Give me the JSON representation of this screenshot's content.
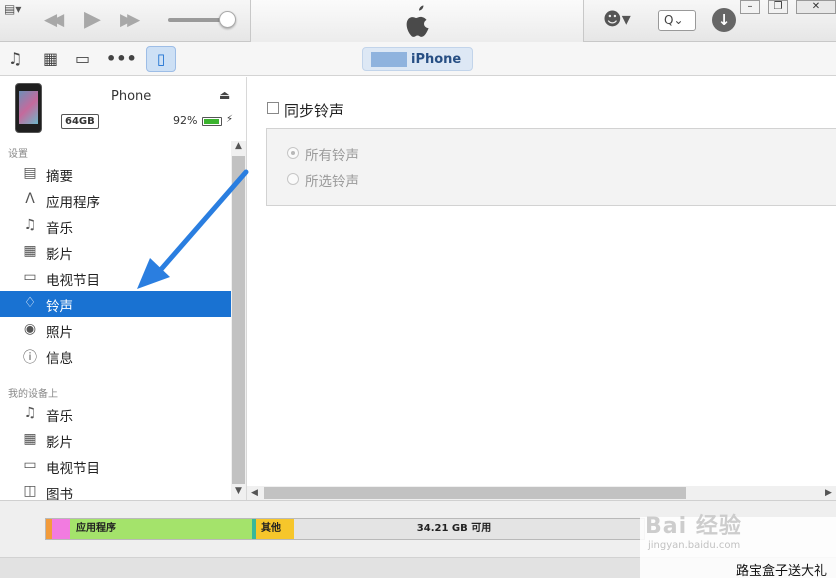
{
  "toolbar": {
    "menu_icon": "menu-icon",
    "prev_icon": "rewind-icon",
    "play_icon": "play-icon",
    "next_icon": "fast-forward-icon",
    "volume_level": 0.85,
    "apple_icon": "apple-logo-icon",
    "account_icon": "account-icon",
    "search_icon": "search-icon",
    "download_icon": "download-icon"
  },
  "navbar": {
    "icons": [
      "music-icon",
      "film-icon",
      "tv-icon",
      "more-icon",
      "iphone-icon"
    ],
    "device_label": "iPhone"
  },
  "device": {
    "name": "Phone",
    "capacity": "64GB",
    "battery": "92%",
    "battery_level": 0.92
  },
  "sidebar": {
    "settings_header": "设置",
    "settings_items": [
      {
        "label": "摘要",
        "icon": "summary-icon"
      },
      {
        "label": "应用程序",
        "icon": "apps-icon"
      },
      {
        "label": "音乐",
        "icon": "music-icon"
      },
      {
        "label": "影片",
        "icon": "film-icon"
      },
      {
        "label": "电视节目",
        "icon": "tv-icon"
      },
      {
        "label": "铃声",
        "icon": "bell-icon",
        "selected": true
      },
      {
        "label": "照片",
        "icon": "camera-icon"
      },
      {
        "label": "信息",
        "icon": "info-icon"
      }
    ],
    "mydevice_header": "我的设备上",
    "mydevice_items": [
      {
        "label": "音乐",
        "icon": "music-icon"
      },
      {
        "label": "影片",
        "icon": "film-icon"
      },
      {
        "label": "电视节目",
        "icon": "tv-icon"
      },
      {
        "label": "图书",
        "icon": "book-icon"
      }
    ]
  },
  "main": {
    "sync_label": "同步铃声",
    "sync_checked": false,
    "options": [
      {
        "label": "所有铃声",
        "selected": true
      },
      {
        "label": "所选铃声",
        "selected": false
      }
    ]
  },
  "capacity": {
    "apps_label": "应用程序",
    "other_label": "其他",
    "free_label": "34.21 GB 可用"
  },
  "watermark": {
    "logo": "Bai 经验",
    "url": "jingyan.baidu.com",
    "text": "路宝盒子送大礼"
  },
  "colors": {
    "selection": "#1972d2",
    "arrow": "#2a7ee0",
    "apps_segment": "#a4e36b",
    "other_segment": "#f6c62b"
  }
}
